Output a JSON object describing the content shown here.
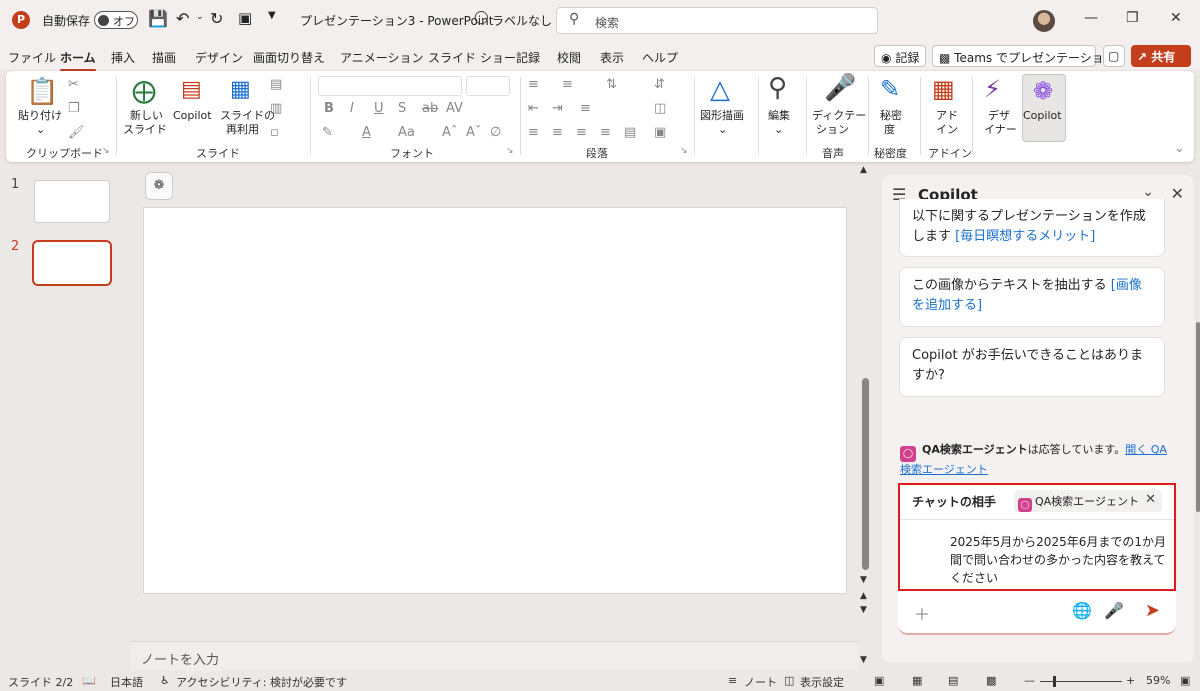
{
  "titlebar": {
    "logo": "P",
    "autosave_label": "自動保存",
    "autosave_state": "オフ",
    "doc_title": "プレゼンテーション3  -  PowerPoint",
    "sensitivity": "ラベルなし",
    "search_placeholder": "検索"
  },
  "menu": {
    "tabs": [
      "ファイル",
      "ホーム",
      "挿入",
      "描画",
      "デザイン",
      "画面切り替え",
      "アニメーション",
      "スライド ショー",
      "記録",
      "校閲",
      "表示",
      "ヘルプ"
    ],
    "active_tab": "ホーム",
    "record_btn": "記録",
    "teams_btn": "Teams でプレゼンテーション",
    "share_btn": "共有"
  },
  "ribbon": {
    "groups": {
      "clipboard": "クリップボード",
      "slides": "スライド",
      "font": "フォント",
      "paragraph": "段落",
      "voice": "音声",
      "sensitivity": "秘密度",
      "addins": "アドイン"
    },
    "paste": "貼り付け",
    "new_slide_1": "新しい",
    "new_slide_2": "スライド",
    "copilot": "Copilot",
    "reuse_1": "スライドの",
    "reuse_2": "再利用",
    "shape_draw": "図形描画",
    "edit": "編集",
    "dictate_1": "ディクテー",
    "dictate_2": "ション",
    "sens_1": "秘密",
    "sens_2": "度",
    "addin_1": "アド",
    "addin_2": "イン",
    "designer_1": "デザ",
    "designer_2": "イナー",
    "copilot_big": "Copilot"
  },
  "thumbs": {
    "slide1": "1",
    "slide2": "2"
  },
  "canvas": {
    "notes_placeholder": "ノートを入力"
  },
  "copilot": {
    "title": "Copilot",
    "suggestion1_text": "以下に関するプレゼンテーションを作成します ",
    "suggestion1_link": "[毎日瞑想するメリット]",
    "suggestion2_text": "この画像からテキストを抽出する ",
    "suggestion2_link": "[画像を追加する]",
    "suggestion3_text": "Copilot がお手伝いできることはありますか?",
    "agent_bold": "QA検索エージェント",
    "agent_rest": "は応答しています。",
    "agent_link": "開く QA検索エージェント",
    "chat_with": "チャットの相手",
    "chip_label": "QA検索エージェント",
    "message": "2025年5月から2025年6月までの1か月間で問い合わせの多かった内容を教えてください"
  },
  "statusbar": {
    "slide_pos": "スライド 2/2",
    "language": "日本語",
    "accessibility": "アクセシビリティ: 検討が必要です",
    "notes": "ノート",
    "display": "表示設定",
    "zoom": "59%"
  },
  "colors": {
    "accent": "#c43e1c",
    "link": "#1a6fd0",
    "highlight_border": "#e01b1b"
  }
}
